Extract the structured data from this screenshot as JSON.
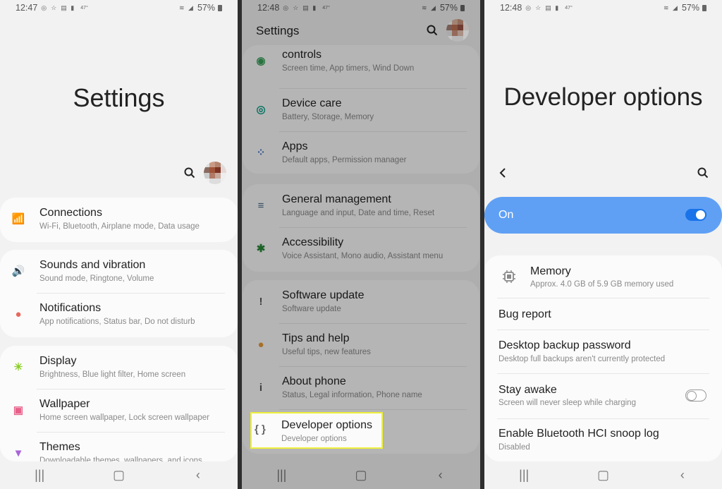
{
  "panels": [
    {
      "status": {
        "time": "12:47",
        "temp": "47°",
        "battery": "57%"
      },
      "title": "Settings",
      "groups": [
        [
          {
            "icon": "wifi-icon",
            "glyph": "📶",
            "color": "#4a9be8",
            "title": "Connections",
            "subtitle": "Wi-Fi, Bluetooth, Airplane mode, Data usage"
          }
        ],
        [
          {
            "icon": "volume-icon",
            "glyph": "🔊",
            "color": "#8a6fe0",
            "title": "Sounds and vibration",
            "subtitle": "Sound mode, Ringtone, Volume"
          },
          {
            "icon": "notification-icon",
            "glyph": "●",
            "color": "#e8685c",
            "title": "Notifications",
            "subtitle": "App notifications, Status bar, Do not disturb"
          }
        ],
        [
          {
            "icon": "brightness-icon",
            "glyph": "☀",
            "color": "#8ccf2a",
            "title": "Display",
            "subtitle": "Brightness, Blue light filter, Home screen"
          },
          {
            "icon": "wallpaper-icon",
            "glyph": "▣",
            "color": "#e8608a",
            "title": "Wallpaper",
            "subtitle": "Home screen wallpaper, Lock screen wallpaper"
          },
          {
            "icon": "themes-icon",
            "glyph": "▼",
            "color": "#a865d8",
            "title": "Themes",
            "subtitle": "Downloadable themes, wallpapers, and icons"
          }
        ]
      ]
    },
    {
      "status": {
        "time": "12:48",
        "temp": "47°",
        "battery": "57%"
      },
      "title": "Settings",
      "groups": [
        [
          {
            "icon": "digital-wellbeing-icon",
            "glyph": "◉",
            "color": "#3aa05a",
            "title": "controls",
            "subtitle": "Screen time, App timers, Wind Down"
          },
          {
            "icon": "device-care-icon",
            "glyph": "◎",
            "color": "#10a088",
            "title": "Device care",
            "subtitle": "Battery, Storage, Memory"
          },
          {
            "icon": "apps-icon",
            "glyph": "⁘",
            "color": "#4a7ac8",
            "title": "Apps",
            "subtitle": "Default apps, Permission manager"
          }
        ],
        [
          {
            "icon": "sliders-icon",
            "glyph": "≡",
            "color": "#4a6a88",
            "title": "General management",
            "subtitle": "Language and input, Date and time, Reset"
          },
          {
            "icon": "accessibility-icon",
            "glyph": "✱",
            "color": "#2a8a3a",
            "title": "Accessibility",
            "subtitle": "Voice Assistant, Mono audio, Assistant menu"
          }
        ],
        [
          {
            "icon": "software-update-icon",
            "glyph": "!",
            "color": "#555555",
            "title": "Software update",
            "subtitle": "Software update"
          },
          {
            "icon": "lightbulb-icon",
            "glyph": "●",
            "color": "#e89a3a",
            "title": "Tips and help",
            "subtitle": "Useful tips, new features"
          },
          {
            "icon": "info-icon",
            "glyph": "i",
            "color": "#555555",
            "title": "About phone",
            "subtitle": "Status, Legal information, Phone name"
          },
          {
            "icon": "braces-icon",
            "glyph": "{ }",
            "color": "#666666",
            "title": "Developer options",
            "subtitle": "Developer options"
          }
        ]
      ]
    },
    {
      "status": {
        "time": "12:48",
        "temp": "47°",
        "battery": "57%"
      },
      "title": "Developer options",
      "master_toggle": {
        "label": "On",
        "state": true,
        "color": "#5fa0f5"
      },
      "items": [
        {
          "icon": "memory-chip-icon",
          "title": "Memory",
          "subtitle": "Approx. 4.0 GB of 5.9 GB memory used"
        },
        {
          "title": "Bug report",
          "subtitle": ""
        },
        {
          "title": "Desktop backup password",
          "subtitle": "Desktop full backups aren't currently protected"
        },
        {
          "title": "Stay awake",
          "subtitle": "Screen will never sleep while charging",
          "toggle": false
        },
        {
          "title": "Enable Bluetooth HCI snoop log",
          "subtitle": "Disabled"
        }
      ]
    }
  ],
  "highlight_color": "#eef03a"
}
